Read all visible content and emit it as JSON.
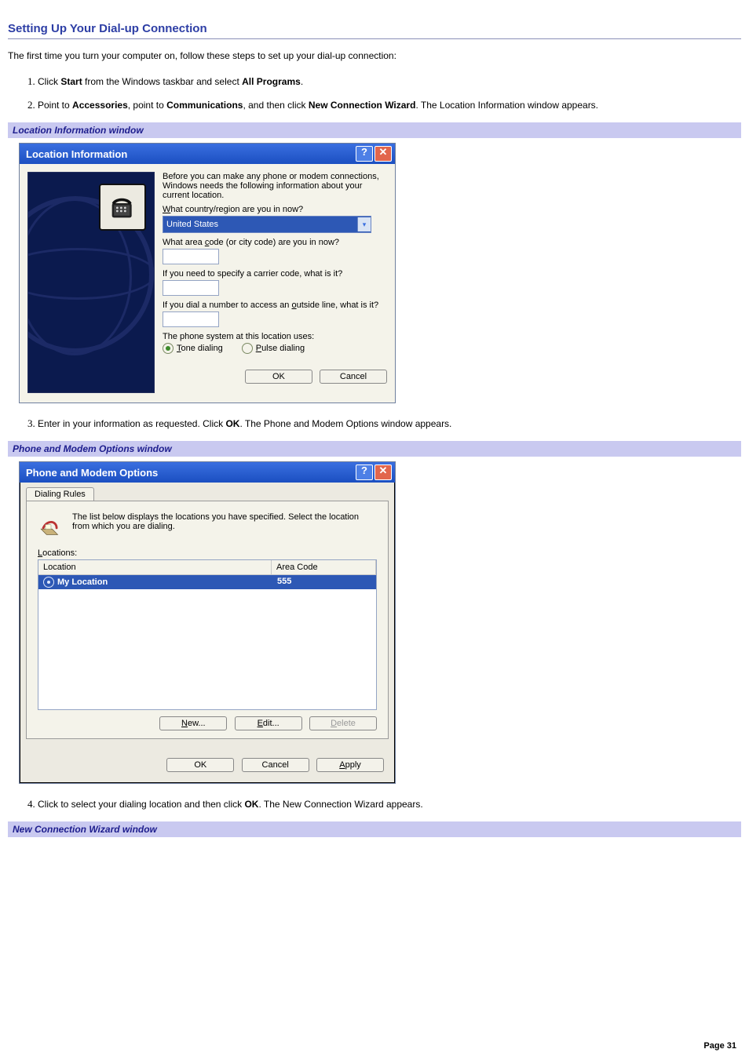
{
  "page": {
    "title": "Setting Up Your Dial-up Connection",
    "intro": "The first time you turn your computer on, follow these steps to set up your dial-up connection:",
    "page_number": "Page 31"
  },
  "steps": {
    "s1": {
      "pre": "Click ",
      "b1": "Start",
      "mid": " from the Windows taskbar and select ",
      "b2": "All Programs",
      "post": "."
    },
    "s2": {
      "pre": "Point to ",
      "b1": "Accessories",
      "mid1": ", point to ",
      "b2": "Communications",
      "mid2": ", and then click ",
      "b3": "New Connection Wizard",
      "post": ". The Location Information window appears."
    },
    "s3": {
      "pre": "Enter in your information as requested. Click ",
      "b1": "OK",
      "post": ". The Phone and Modem Options window appears."
    },
    "s4": {
      "pre": "Click to select your dialing location and then click ",
      "b1": "OK",
      "post": ". The New Connection Wizard appears."
    }
  },
  "captions": {
    "c1": "Location Information window",
    "c2": "Phone and Modem Options window",
    "c3": "New Connection Wizard window"
  },
  "locinfo": {
    "title": "Location Information",
    "intro": "Before you can make any phone or modem connections, Windows needs the following information about your current location.",
    "q_country_pre": "W",
    "q_country_post": "hat country/region are you in now?",
    "country_value": "United States",
    "q_area_pre": "What area ",
    "q_area_u": "c",
    "q_area_post": "ode (or city code) are you in now?",
    "q_carrier": "If you need to specify a carrier code, what is it?",
    "q_outside_pre": "If you dial a number to access an ",
    "q_outside_u": "o",
    "q_outside_post": "utside line, what is it?",
    "q_system": "The phone system at this location uses:",
    "radio_tone_u": "T",
    "radio_tone_post": "one dialing",
    "radio_pulse_u": "P",
    "radio_pulse_post": "ulse dialing",
    "ok": "OK",
    "cancel": "Cancel"
  },
  "phonemodem": {
    "title": "Phone and Modem Options",
    "tab": "Dialing Rules",
    "desc": "The list below displays the locations you have specified. Select the location from which you are dialing.",
    "locations_label_u": "L",
    "locations_label_post": "ocations:",
    "col_location": "Location",
    "col_areacode": "Area Code",
    "row_location": "My Location",
    "row_areacode": "555",
    "btn_new_u": "N",
    "btn_new_post": "ew...",
    "btn_edit_u": "E",
    "btn_edit_post": "dit...",
    "btn_delete_u": "D",
    "btn_delete_post": "elete",
    "ok": "OK",
    "cancel": "Cancel",
    "apply_u": "A",
    "apply_post": "pply"
  }
}
